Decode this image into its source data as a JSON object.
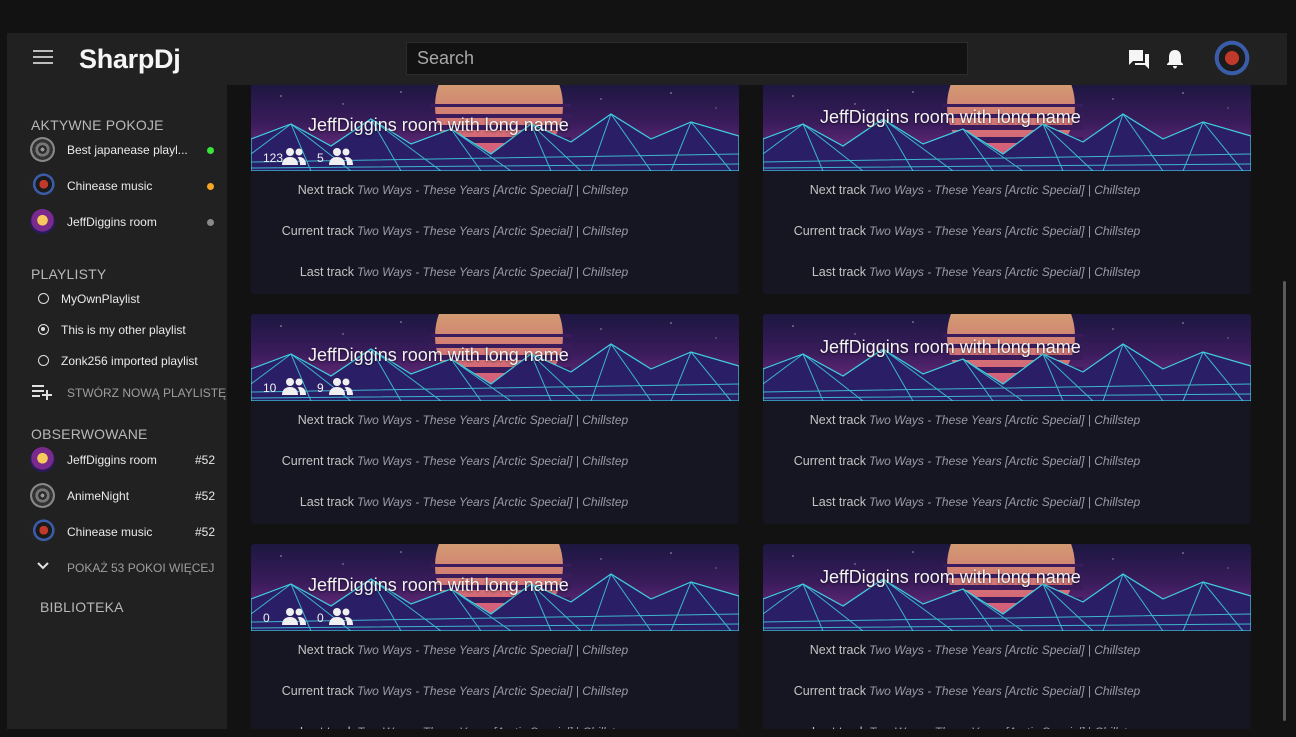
{
  "app": {
    "title": "SharpDj"
  },
  "search": {
    "placeholder": "Search"
  },
  "sidebar": {
    "active_rooms_header": "AKTYWNE POKOJE",
    "active_rooms": [
      {
        "name": "Best japanease playl...",
        "avatar": "vinyl-disc",
        "status_color": "#39e339"
      },
      {
        "name": "Chinease music",
        "avatar": "red-character",
        "status_color": "#f5a623"
      },
      {
        "name": "JeffDiggins room",
        "avatar": "sunset",
        "status_color": "#8a8a8a"
      }
    ],
    "playlists_header": "PLAYLISTY",
    "playlists": [
      {
        "name": "MyOwnPlaylist",
        "selected": false
      },
      {
        "name": "This is my other playlist",
        "selected": true
      },
      {
        "name": "Zonk256 imported playlist",
        "selected": false
      }
    ],
    "create_playlist_label": "STWÓRZ NOWĄ PLAYLISTĘ",
    "observed_header": "OBSERWOWANE",
    "observed": [
      {
        "name": "JeffDiggins room",
        "number": "#52",
        "avatar": "sunset"
      },
      {
        "name": "AnimeNight",
        "number": "#52",
        "avatar": "vinyl-disc"
      },
      {
        "name": "Chinease music",
        "number": "#52",
        "avatar": "red-character"
      }
    ],
    "show_more_label": "POKAŻ 53 POKOI WIĘCEJ",
    "library_label": "BIBLIOTEKA"
  },
  "cards": [
    {
      "title": "JeffDiggins room with long name",
      "count1": "123",
      "count2": "5",
      "next_label": "Next track",
      "next": "Two Ways - These Years [Arctic Special] | Chillstep",
      "current_label": "Current track",
      "current": "Two Ways - These Years [Arctic Special] | Chillstep",
      "last_label": "Last track",
      "last": "Two Ways - These Years [Arctic Special] | Chillstep"
    },
    {
      "title": "JeffDiggins room with long name",
      "next_label": "Next track",
      "next": "Two Ways - These Years [Arctic Special] | Chillstep",
      "current_label": "Current track",
      "current": "Two Ways - These Years [Arctic Special] | Chillstep",
      "last_label": "Last track",
      "last": "Two Ways - These Years [Arctic Special] | Chillstep"
    },
    {
      "title": "JeffDiggins room with long name",
      "count1": "10",
      "count2": "9",
      "next_label": "Next track",
      "next": "Two Ways - These Years [Arctic Special] | Chillstep",
      "current_label": "Current track",
      "current": "Two Ways - These Years [Arctic Special] | Chillstep",
      "last_label": "Last track",
      "last": "Two Ways - These Years [Arctic Special] | Chillstep"
    },
    {
      "title": "JeffDiggins room with long name",
      "next_label": "Next track",
      "next": "Two Ways - These Years [Arctic Special] | Chillstep",
      "current_label": "Current track",
      "current": "Two Ways - These Years [Arctic Special] | Chillstep",
      "last_label": "Last track",
      "last": "Two Ways - These Years [Arctic Special] | Chillstep"
    },
    {
      "title": "JeffDiggins room with long name",
      "count1": "0",
      "count2": "0",
      "next_label": "Next track",
      "next": "Two Ways - These Years [Arctic Special] | Chillstep",
      "current_label": "Current track",
      "current": "Two Ways - These Years [Arctic Special] | Chillstep",
      "last_label": "Last track",
      "last": "Two Ways - These Years [Arctic Special] | Chillstep"
    },
    {
      "title": "JeffDiggins room with long name",
      "next_label": "Next track",
      "next": "Two Ways - These Years [Arctic Special] | Chillstep",
      "current_label": "Current track",
      "current": "Two Ways - These Years [Arctic Special] | Chillstep",
      "last_label": "Last track",
      "last": "Two Ways - These Years [Arctic Special] | Chillstep"
    }
  ],
  "icons": {
    "menu": "hamburger-menu-icon",
    "chat": "chat-bubbles-icon",
    "notifications": "bell-icon",
    "people": "people-icon",
    "create": "playlist-add-icon",
    "expand": "chevron-down-icon"
  }
}
